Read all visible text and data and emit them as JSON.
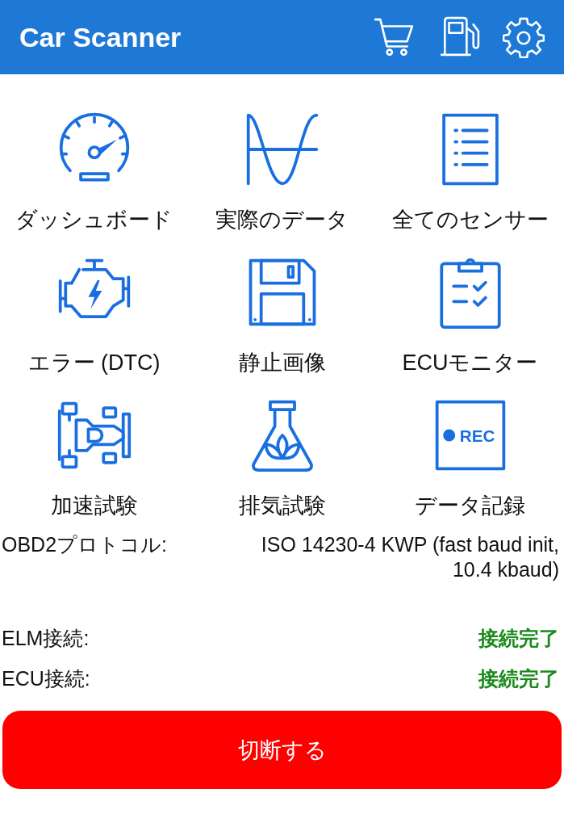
{
  "app_bar": {
    "title": "Car Scanner"
  },
  "tile_rows": [
    {
      "tiles": [
        {
          "label": "ダッシュボード"
        },
        {
          "label": "実際のデータ"
        },
        {
          "label": "全てのセンサー"
        }
      ]
    },
    {
      "tiles": [
        {
          "label": "エラー (DTC)"
        },
        {
          "label": "静止画像"
        },
        {
          "label": "ECUモニター"
        }
      ]
    },
    {
      "tiles": [
        {
          "label": "加速試験"
        },
        {
          "label": "排気試験"
        },
        {
          "label": "データ記録",
          "badge": "REC"
        }
      ]
    }
  ],
  "status": [
    {
      "label": "OBD2プロトコル:",
      "value": "ISO 14230-4 KWP (fast baud init, 10.4 kbaud)",
      "kind": "plain"
    },
    {
      "label": "ELM接続:",
      "value": "接続完了",
      "kind": "success"
    },
    {
      "label": "ECU接続:",
      "value": "接続完了",
      "kind": "success"
    }
  ],
  "disconnect_button": "切断する"
}
